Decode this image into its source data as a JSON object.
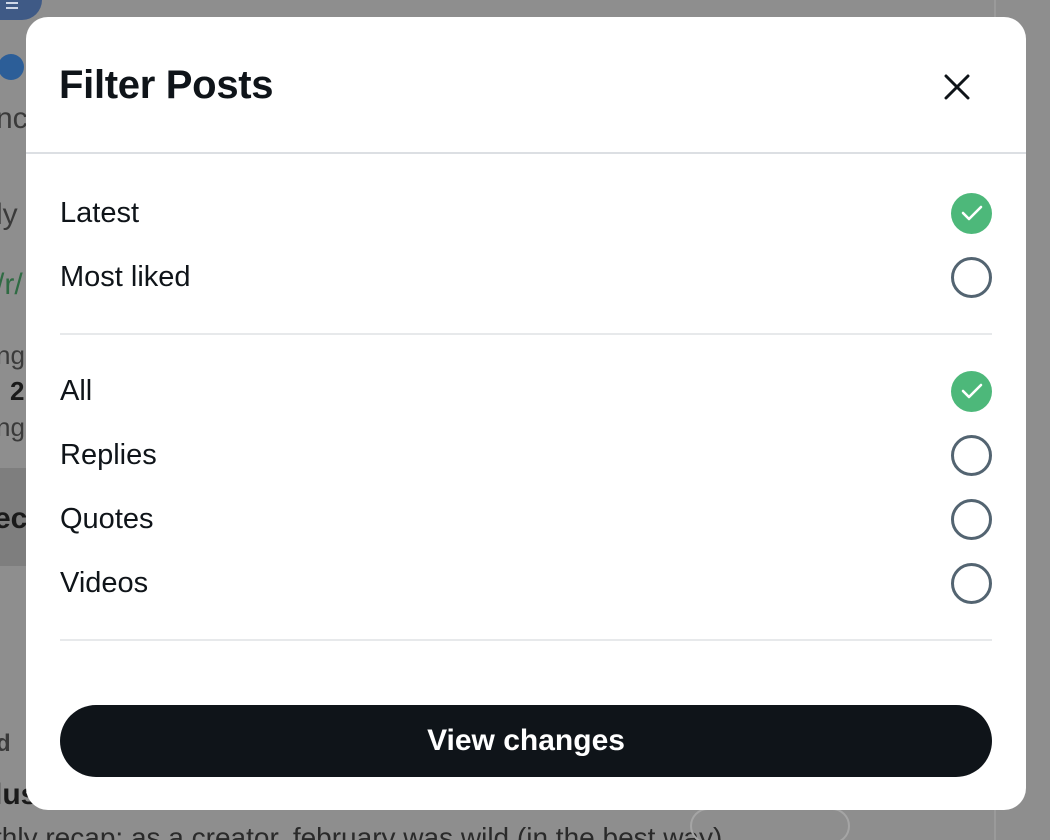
{
  "background": {
    "fragments": [
      "nc",
      "ly",
      "/r/",
      "ng",
      "2",
      "ngl",
      "ec",
      "d",
      "lus",
      "thly recap: as a creator, february was wild (in the best way)"
    ]
  },
  "modal": {
    "title": "Filter Posts",
    "close_icon": "close-icon",
    "sort_options": [
      {
        "label": "Latest",
        "selected": true
      },
      {
        "label": "Most liked",
        "selected": false
      }
    ],
    "type_options": [
      {
        "label": "All",
        "selected": true
      },
      {
        "label": "Replies",
        "selected": false
      },
      {
        "label": "Quotes",
        "selected": false
      },
      {
        "label": "Videos",
        "selected": false
      }
    ],
    "submit_label": "View changes"
  },
  "colors": {
    "checked": "#4db87a",
    "unchecked_border": "#536471",
    "button": "#0f1419",
    "text": "#0f1419"
  }
}
